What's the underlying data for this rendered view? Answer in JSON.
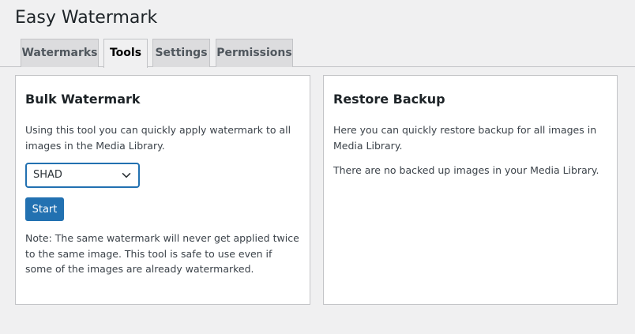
{
  "page": {
    "title": "Easy Watermark"
  },
  "tabs": [
    {
      "label": "Watermarks",
      "active": false
    },
    {
      "label": "Tools",
      "active": true
    },
    {
      "label": "Settings",
      "active": false
    },
    {
      "label": "Permissions",
      "active": false
    }
  ],
  "bulk_watermark": {
    "title": "Bulk Watermark",
    "description": "Using this tool you can quickly apply watermark to all images in the Media Library.",
    "select": {
      "selected": "SHAD"
    },
    "start_label": "Start",
    "note": "Note: The same watermark will never get applied twice to the same image. This tool is safe to use even if some of the images are already watermarked."
  },
  "restore_backup": {
    "title": "Restore Backup",
    "description": "Here you can quickly restore backup for all images in Media Library.",
    "empty_message": "There are no backed up images in your Media Library."
  },
  "colors": {
    "background": "#f0f0f1",
    "card": "#ffffff",
    "border": "#c3c4c7",
    "accent": "#2271b1",
    "tab_inactive": "#dcdcde",
    "text": "#1d2327"
  },
  "icons": {
    "select_chevron": "chevron-down-icon"
  }
}
